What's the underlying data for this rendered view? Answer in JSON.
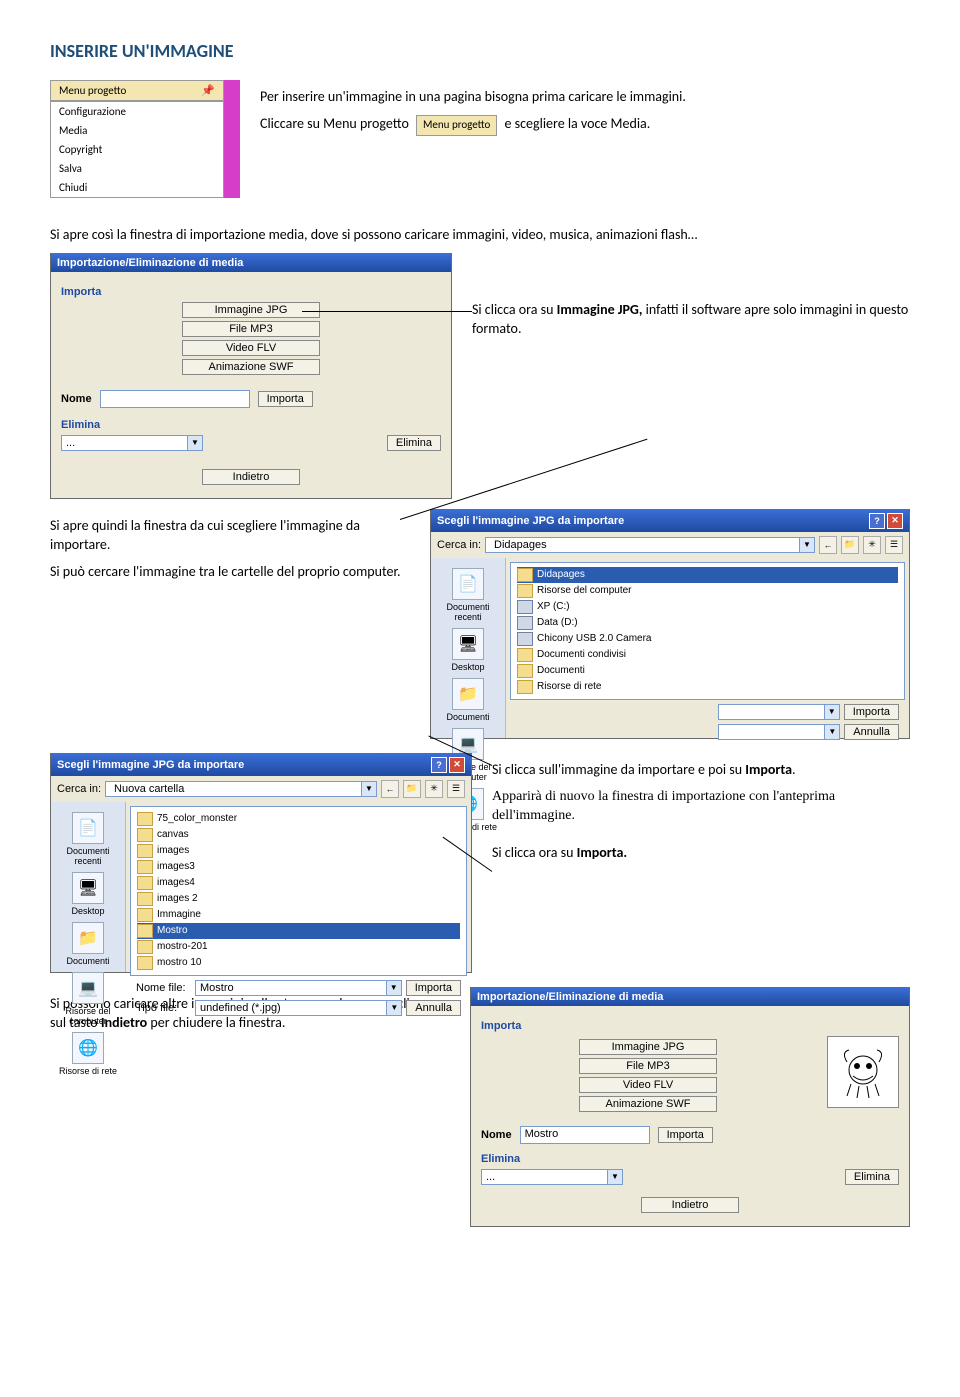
{
  "heading": "INSERIRE UN'IMMAGINE",
  "intro1": "Per inserire un'immagine in una pagina bisogna prima caricare le immagini.",
  "intro2a": "Cliccare su Menu progetto",
  "intro2b": "e scegliere la voce Media.",
  "menu": {
    "tab_label": "Menu progetto",
    "pin_icon": "📌",
    "items": [
      "Configurazione",
      "Media",
      "Copyright",
      "Salva",
      "Chiudi"
    ]
  },
  "para2": "Si apre così la finestra di importazione media, dove si possono caricare immagini, video, musica, animazioni flash…",
  "callout1a": "Si clicca ora su ",
  "callout1b": "Immagine JPG,",
  "callout1c": " infatti il software apre solo immagini in questo formato.",
  "import_panel": {
    "title": "Importazione/Eliminazione di media",
    "importa": "Importa",
    "btn_jpg": "Immagine JPG",
    "btn_mp3": "File MP3",
    "btn_flv": "Video FLV",
    "btn_swf": "Animazione SWF",
    "nome": "Nome",
    "elimina": "Elimina",
    "elimina_placeholder": "...",
    "indietro": "Indietro"
  },
  "para3a": "Si apre quindi la finestra da cui scegliere l'immagine da importare.",
  "para3b": "Si può cercare l'immagine tra le cartelle del proprio computer.",
  "dlg1": {
    "title": "Scegli l'immagine JPG da importare",
    "cerca_in": "Cerca in:",
    "folder": "Didapages",
    "places": [
      "Documenti recenti",
      "Desktop",
      "Documenti",
      "Risorse del computer",
      "Risorse di rete"
    ],
    "items": [
      {
        "icon": "folder",
        "label": "Didapages",
        "sel": true
      },
      {
        "icon": "folder",
        "label": "Risorse del computer"
      },
      {
        "icon": "disk",
        "label": "XP (C:)"
      },
      {
        "icon": "disk",
        "label": "Data (D:)"
      },
      {
        "icon": "disk",
        "label": "Chicony USB 2.0 Camera"
      },
      {
        "icon": "folder",
        "label": "Documenti condivisi"
      },
      {
        "icon": "folder",
        "label": "Documenti"
      },
      {
        "icon": "folder",
        "label": "Risorse di rete"
      }
    ],
    "importa": "Importa",
    "annulla": "Annulla"
  },
  "dlg2": {
    "title": "Scegli l'immagine JPG da importare",
    "cerca_in": "Cerca in:",
    "folder": "Nuova cartella",
    "places": [
      "Documenti recenti",
      "Desktop",
      "Documenti",
      "Risorse del computer",
      "Risorse di rete"
    ],
    "items": [
      {
        "label": "75_color_monster"
      },
      {
        "label": "canvas"
      },
      {
        "label": "images"
      },
      {
        "label": "images3"
      },
      {
        "label": "images4"
      },
      {
        "label": "images 2"
      },
      {
        "label": "Immagine"
      },
      {
        "label": "Mostro",
        "sel": true
      },
      {
        "label": "mostro-201"
      },
      {
        "label": "mostro 10"
      }
    ],
    "nome_file": "Nome file:",
    "nome_val": "Mostro",
    "tipo_file": "Tipo file:",
    "tipo_val": "undefined (*.jpg)",
    "importa": "Importa",
    "annulla": "Annulla"
  },
  "callout2a": "Si clicca sull'immagine da importare e poi su ",
  "callout2b": "Importa",
  "callout2c": "Apparirà di nuovo la finestra di importazione con l'anteprima dell'immagine.",
  "callout2d": "Si clicca ora su ",
  "callout2e": "Importa.",
  "para_last": "Si possono caricare altre immagini nello stesso modo oppure cliccare sul tasto ",
  "para_last_b": "Indietro",
  "para_last_c": " per chiudere la finestra.",
  "import_panel2": {
    "title": "Importazione/Eliminazione di media",
    "importa": "Importa",
    "nome": "Nome",
    "nome_val": "Mostro",
    "elimina": "Elimina",
    "elimina_placeholder": "...",
    "indietro": "Indietro"
  }
}
